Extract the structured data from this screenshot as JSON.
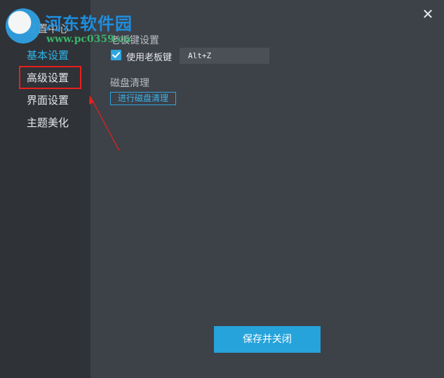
{
  "window": {
    "title": "设置中心",
    "close_icon": "close-icon"
  },
  "sidebar": {
    "items": [
      {
        "label": "基本设置"
      },
      {
        "label": "高级设置"
      },
      {
        "label": "界面设置"
      },
      {
        "label": "主题美化"
      }
    ],
    "active_index": 0,
    "highlighted_index": 1
  },
  "content": {
    "boss_key": {
      "section_title": "老板键设置",
      "checkbox_label": "使用老板键",
      "checked": true,
      "hotkey_value": "Alt+Z"
    },
    "disk_clean": {
      "section_title": "磁盘清理",
      "button_label": "进行磁盘清理"
    },
    "save_button_label": "保存并关闭"
  },
  "watermark": {
    "title": "河东软件园",
    "url": "www.pc0359.cn"
  },
  "colors": {
    "accent": "#26a3db",
    "highlight_box": "#e8201d",
    "annotation_arrow": "#e8201d"
  }
}
